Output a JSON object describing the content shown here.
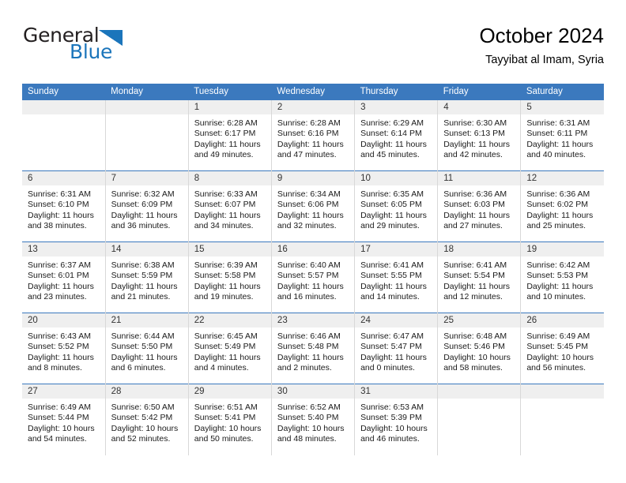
{
  "brand": {
    "name_part1": "General",
    "name_part2": "Blue",
    "logo_icon": "triangle-flag-icon",
    "colors": {
      "blue": "#1b75bb",
      "dark": "#231f20"
    }
  },
  "header": {
    "title": "October 2024",
    "subtitle": "Tayyibat al Imam, Syria"
  },
  "theme": {
    "header_row_bg": "#3b79be",
    "daynum_bg": "#efefef",
    "cell_border": "#d8d8d8",
    "week_separator": "#3b79be"
  },
  "calendar": {
    "weekday_headers": [
      "Sunday",
      "Monday",
      "Tuesday",
      "Wednesday",
      "Thursday",
      "Friday",
      "Saturday"
    ],
    "weeks": [
      [
        {
          "blank": true
        },
        {
          "blank": true
        },
        {
          "day": "1",
          "sunrise": "Sunrise: 6:28 AM",
          "sunset": "Sunset: 6:17 PM",
          "daylight": "Daylight: 11 hours and 49 minutes."
        },
        {
          "day": "2",
          "sunrise": "Sunrise: 6:28 AM",
          "sunset": "Sunset: 6:16 PM",
          "daylight": "Daylight: 11 hours and 47 minutes."
        },
        {
          "day": "3",
          "sunrise": "Sunrise: 6:29 AM",
          "sunset": "Sunset: 6:14 PM",
          "daylight": "Daylight: 11 hours and 45 minutes."
        },
        {
          "day": "4",
          "sunrise": "Sunrise: 6:30 AM",
          "sunset": "Sunset: 6:13 PM",
          "daylight": "Daylight: 11 hours and 42 minutes."
        },
        {
          "day": "5",
          "sunrise": "Sunrise: 6:31 AM",
          "sunset": "Sunset: 6:11 PM",
          "daylight": "Daylight: 11 hours and 40 minutes."
        }
      ],
      [
        {
          "day": "6",
          "sunrise": "Sunrise: 6:31 AM",
          "sunset": "Sunset: 6:10 PM",
          "daylight": "Daylight: 11 hours and 38 minutes."
        },
        {
          "day": "7",
          "sunrise": "Sunrise: 6:32 AM",
          "sunset": "Sunset: 6:09 PM",
          "daylight": "Daylight: 11 hours and 36 minutes."
        },
        {
          "day": "8",
          "sunrise": "Sunrise: 6:33 AM",
          "sunset": "Sunset: 6:07 PM",
          "daylight": "Daylight: 11 hours and 34 minutes."
        },
        {
          "day": "9",
          "sunrise": "Sunrise: 6:34 AM",
          "sunset": "Sunset: 6:06 PM",
          "daylight": "Daylight: 11 hours and 32 minutes."
        },
        {
          "day": "10",
          "sunrise": "Sunrise: 6:35 AM",
          "sunset": "Sunset: 6:05 PM",
          "daylight": "Daylight: 11 hours and 29 minutes."
        },
        {
          "day": "11",
          "sunrise": "Sunrise: 6:36 AM",
          "sunset": "Sunset: 6:03 PM",
          "daylight": "Daylight: 11 hours and 27 minutes."
        },
        {
          "day": "12",
          "sunrise": "Sunrise: 6:36 AM",
          "sunset": "Sunset: 6:02 PM",
          "daylight": "Daylight: 11 hours and 25 minutes."
        }
      ],
      [
        {
          "day": "13",
          "sunrise": "Sunrise: 6:37 AM",
          "sunset": "Sunset: 6:01 PM",
          "daylight": "Daylight: 11 hours and 23 minutes."
        },
        {
          "day": "14",
          "sunrise": "Sunrise: 6:38 AM",
          "sunset": "Sunset: 5:59 PM",
          "daylight": "Daylight: 11 hours and 21 minutes."
        },
        {
          "day": "15",
          "sunrise": "Sunrise: 6:39 AM",
          "sunset": "Sunset: 5:58 PM",
          "daylight": "Daylight: 11 hours and 19 minutes."
        },
        {
          "day": "16",
          "sunrise": "Sunrise: 6:40 AM",
          "sunset": "Sunset: 5:57 PM",
          "daylight": "Daylight: 11 hours and 16 minutes."
        },
        {
          "day": "17",
          "sunrise": "Sunrise: 6:41 AM",
          "sunset": "Sunset: 5:55 PM",
          "daylight": "Daylight: 11 hours and 14 minutes."
        },
        {
          "day": "18",
          "sunrise": "Sunrise: 6:41 AM",
          "sunset": "Sunset: 5:54 PM",
          "daylight": "Daylight: 11 hours and 12 minutes."
        },
        {
          "day": "19",
          "sunrise": "Sunrise: 6:42 AM",
          "sunset": "Sunset: 5:53 PM",
          "daylight": "Daylight: 11 hours and 10 minutes."
        }
      ],
      [
        {
          "day": "20",
          "sunrise": "Sunrise: 6:43 AM",
          "sunset": "Sunset: 5:52 PM",
          "daylight": "Daylight: 11 hours and 8 minutes."
        },
        {
          "day": "21",
          "sunrise": "Sunrise: 6:44 AM",
          "sunset": "Sunset: 5:50 PM",
          "daylight": "Daylight: 11 hours and 6 minutes."
        },
        {
          "day": "22",
          "sunrise": "Sunrise: 6:45 AM",
          "sunset": "Sunset: 5:49 PM",
          "daylight": "Daylight: 11 hours and 4 minutes."
        },
        {
          "day": "23",
          "sunrise": "Sunrise: 6:46 AM",
          "sunset": "Sunset: 5:48 PM",
          "daylight": "Daylight: 11 hours and 2 minutes."
        },
        {
          "day": "24",
          "sunrise": "Sunrise: 6:47 AM",
          "sunset": "Sunset: 5:47 PM",
          "daylight": "Daylight: 11 hours and 0 minutes."
        },
        {
          "day": "25",
          "sunrise": "Sunrise: 6:48 AM",
          "sunset": "Sunset: 5:46 PM",
          "daylight": "Daylight: 10 hours and 58 minutes."
        },
        {
          "day": "26",
          "sunrise": "Sunrise: 6:49 AM",
          "sunset": "Sunset: 5:45 PM",
          "daylight": "Daylight: 10 hours and 56 minutes."
        }
      ],
      [
        {
          "day": "27",
          "sunrise": "Sunrise: 6:49 AM",
          "sunset": "Sunset: 5:44 PM",
          "daylight": "Daylight: 10 hours and 54 minutes."
        },
        {
          "day": "28",
          "sunrise": "Sunrise: 6:50 AM",
          "sunset": "Sunset: 5:42 PM",
          "daylight": "Daylight: 10 hours and 52 minutes."
        },
        {
          "day": "29",
          "sunrise": "Sunrise: 6:51 AM",
          "sunset": "Sunset: 5:41 PM",
          "daylight": "Daylight: 10 hours and 50 minutes."
        },
        {
          "day": "30",
          "sunrise": "Sunrise: 6:52 AM",
          "sunset": "Sunset: 5:40 PM",
          "daylight": "Daylight: 10 hours and 48 minutes."
        },
        {
          "day": "31",
          "sunrise": "Sunrise: 6:53 AM",
          "sunset": "Sunset: 5:39 PM",
          "daylight": "Daylight: 10 hours and 46 minutes."
        },
        {
          "blank": true
        },
        {
          "blank": true
        }
      ]
    ]
  }
}
